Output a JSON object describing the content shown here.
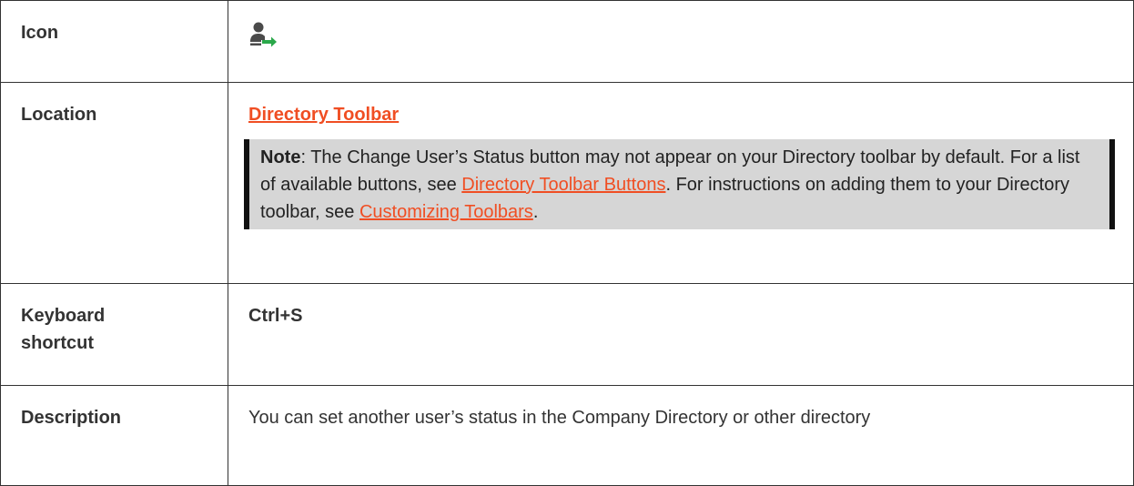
{
  "rows": {
    "icon": {
      "label": "Icon",
      "icon_name": "change-user-status-icon",
      "icon_colors": {
        "person": "#4a4a4a",
        "arrow": "#2aa84a"
      }
    },
    "location": {
      "label": "Location",
      "link_text": "Directory Toolbar",
      "note": {
        "bold_label": "Note",
        "text_before_link1": ": The Change User’s Status button may not appear on your Directory toolbar by default. For a list of available buttons, see ",
        "link1_text": "Directory Toolbar Buttons",
        "text_between_links": ". For instructions on adding them to your Directory toolbar, see ",
        "link2_text": "Customizing Toolbars",
        "text_after_link2": "."
      }
    },
    "shortcut": {
      "label": "Keyboard shortcut",
      "value": "Ctrl+S"
    },
    "description": {
      "label": "Description",
      "value": "You can set another user’s status in the Company Directory or other directory"
    }
  },
  "colors": {
    "link": "#f04e23",
    "note_background": "#d6d6d6",
    "note_border": "#111111",
    "table_border": "#333333"
  }
}
